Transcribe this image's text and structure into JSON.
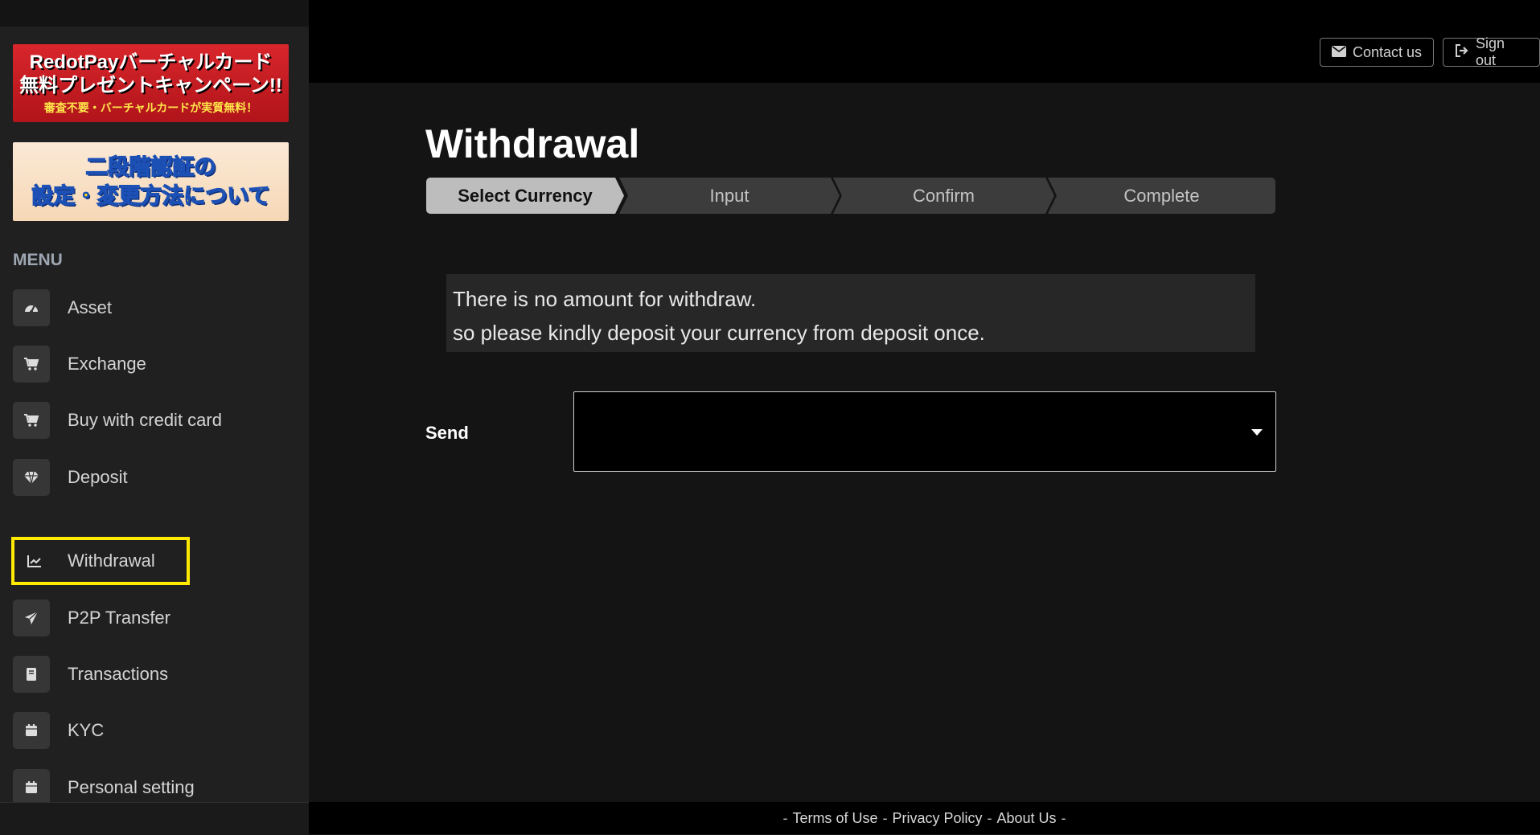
{
  "banners": {
    "campaign": {
      "line1": "RedotPayバーチャルカード",
      "line2": "無料プレゼントキャンペーン!!",
      "line3": "審査不要・バーチャルカードが実質無料！"
    },
    "two_factor": {
      "line1": "二段階認証の",
      "line2": "設定・変更方法について"
    }
  },
  "sidebar": {
    "menu_title": "MENU",
    "items": [
      {
        "label": "Asset",
        "icon": "dashboard-icon"
      },
      {
        "label": "Exchange",
        "icon": "cart-icon"
      },
      {
        "label": "Buy with credit card",
        "icon": "cart-icon"
      },
      {
        "label": "Deposit",
        "icon": "diamond-icon"
      },
      {
        "label": "Withdrawal",
        "icon": "chart-icon",
        "active": true
      },
      {
        "label": "P2P Transfer",
        "icon": "paper-plane-icon"
      },
      {
        "label": "Transactions",
        "icon": "book-icon"
      },
      {
        "label": "KYC",
        "icon": "calendar-icon"
      },
      {
        "label": "Personal setting",
        "icon": "calendar-icon"
      }
    ]
  },
  "header": {
    "contact_label": "Contact us",
    "signout_label": "Sign out"
  },
  "main": {
    "title": "Withdrawal",
    "steps": [
      "Select Currency",
      "Input",
      "Confirm",
      "Complete"
    ],
    "notice": {
      "line1": "There is no amount for withdraw.",
      "line2": "so please kindly deposit your currency from deposit once."
    },
    "send_label": "Send",
    "send_value": ""
  },
  "footer": {
    "terms": "Terms of Use",
    "privacy": "Privacy Policy",
    "about": "About Us"
  },
  "colors": {
    "highlight": "#ffea00",
    "active_step": "#bdbdbd"
  }
}
